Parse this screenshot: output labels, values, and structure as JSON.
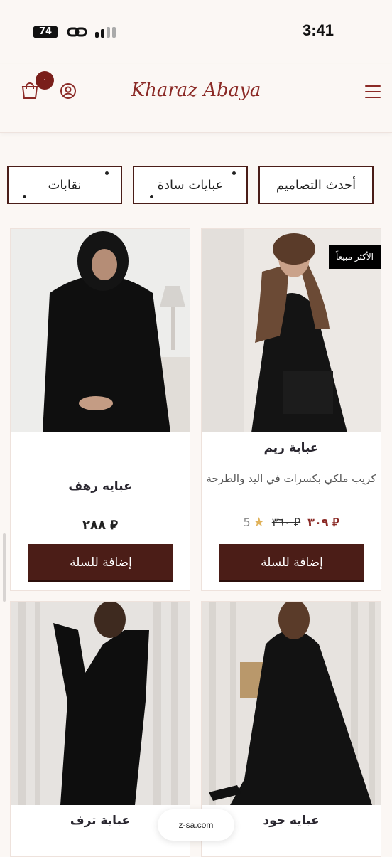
{
  "status": {
    "time": "3:41",
    "battery": "74"
  },
  "header": {
    "brand": "Kharaz Abaya",
    "cart_count": "٠"
  },
  "categories": [
    {
      "label": "نقابات"
    },
    {
      "label": "عبايات سادة"
    },
    {
      "label": "أحدث التصاميم"
    }
  ],
  "products": [
    {
      "name": "عباية ريم",
      "badge": "الأكثر مبيعاً",
      "description": "كريب ملكي بكسرات في اليد والطرحة",
      "price": "٣٠٩ ⃁",
      "old_price": "٣٦٠ ⃁",
      "rating": "5",
      "add_label": "إضافة للسلة"
    },
    {
      "name": "عبايه رهف",
      "price": "٢٨٨ ⃁",
      "add_label": "إضافة للسلة"
    },
    {
      "name": "عبايه جود"
    },
    {
      "name": "عباية ترف"
    }
  ],
  "browser": {
    "url": "z-sa.com"
  },
  "colors": {
    "brand": "#8b2a26",
    "button": "#4b1d17",
    "badge": "#000000"
  }
}
